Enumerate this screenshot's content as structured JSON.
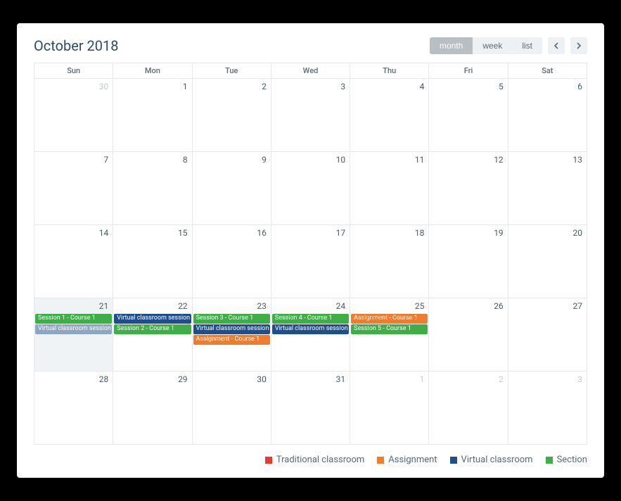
{
  "title": "October 2018",
  "views": {
    "month": "month",
    "week": "week",
    "list": "list",
    "active": "month"
  },
  "weekdays": [
    "Sun",
    "Mon",
    "Tue",
    "Wed",
    "Thu",
    "Fri",
    "Sat"
  ],
  "colors": {
    "traditional": "#e43d30",
    "assignment": "#ed7d31",
    "virtual": "#1f4e8c",
    "section": "#3fae49"
  },
  "legend": {
    "traditional": "Traditional classroom",
    "assignment": "Assignment",
    "virtual": "Virtual classroom",
    "section": "Section"
  },
  "weeks": [
    [
      {
        "n": "30",
        "other": true
      },
      {
        "n": "1"
      },
      {
        "n": "2"
      },
      {
        "n": "3"
      },
      {
        "n": "4"
      },
      {
        "n": "5"
      },
      {
        "n": "6"
      }
    ],
    [
      {
        "n": "7"
      },
      {
        "n": "8"
      },
      {
        "n": "9"
      },
      {
        "n": "10"
      },
      {
        "n": "11"
      },
      {
        "n": "12"
      },
      {
        "n": "13"
      }
    ],
    [
      {
        "n": "14"
      },
      {
        "n": "15"
      },
      {
        "n": "16"
      },
      {
        "n": "17"
      },
      {
        "n": "18"
      },
      {
        "n": "19"
      },
      {
        "n": "20"
      }
    ],
    [
      {
        "n": "21",
        "today": true,
        "events": [
          {
            "label": "Session 1 - Course 1",
            "cls": "ev-section"
          },
          {
            "label": "Virtual classroom session - C",
            "cls": "ev-virtual-light"
          }
        ]
      },
      {
        "n": "22",
        "events": [
          {
            "label": "Virtual classroom session - C",
            "cls": "ev-virtual"
          },
          {
            "label": "Session 2 - Course 1",
            "cls": "ev-section"
          }
        ]
      },
      {
        "n": "23",
        "events": [
          {
            "label": "Session 3 - Course 1",
            "cls": "ev-section"
          },
          {
            "label": "Virtual classroom session - C",
            "cls": "ev-virtual"
          },
          {
            "label": "Assignment - Course 1",
            "cls": "ev-assignment"
          }
        ]
      },
      {
        "n": "24",
        "events": [
          {
            "label": "Session 4 - Course 1",
            "cls": "ev-section"
          },
          {
            "label": "Virtual classroom session - C",
            "cls": "ev-virtual"
          }
        ]
      },
      {
        "n": "25",
        "events": [
          {
            "label": "Assignment - Course 1",
            "cls": "ev-assignment"
          },
          {
            "label": "Session 5 - Course 1",
            "cls": "ev-section"
          }
        ]
      },
      {
        "n": "26"
      },
      {
        "n": "27"
      }
    ],
    [
      {
        "n": "28"
      },
      {
        "n": "29"
      },
      {
        "n": "30"
      },
      {
        "n": "31"
      },
      {
        "n": "1",
        "other": true
      },
      {
        "n": "2",
        "other": true
      },
      {
        "n": "3",
        "other": true
      }
    ]
  ]
}
